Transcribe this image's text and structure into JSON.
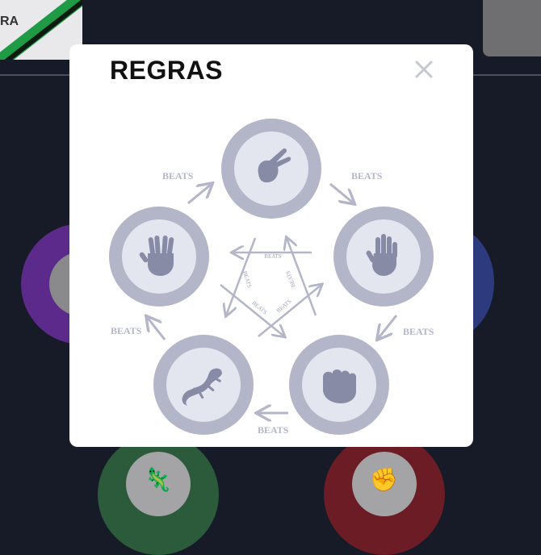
{
  "background": {
    "logo_text": "RA"
  },
  "modal": {
    "title": "REGRAS",
    "close_icon": "close-icon"
  },
  "diagram": {
    "nodes": [
      {
        "id": "scissors",
        "icon": "scissors-hand-icon"
      },
      {
        "id": "paper",
        "icon": "paper-hand-icon"
      },
      {
        "id": "rock",
        "icon": "rock-fist-icon"
      },
      {
        "id": "lizard",
        "icon": "lizard-icon"
      },
      {
        "id": "spock",
        "icon": "spock-hand-icon"
      }
    ],
    "outer_labels": [
      "BEATS",
      "BEATS",
      "BEATS",
      "BEATS",
      "BEATS"
    ],
    "inner_labels": [
      "BEATS",
      "BEATS",
      "BEATS",
      "BEATS",
      "BEATS"
    ],
    "colors": {
      "ring": "#b3b6c9",
      "inner": "#e3e5ef",
      "icon": "#878ba6",
      "arrow": "#b3b6c9"
    }
  }
}
